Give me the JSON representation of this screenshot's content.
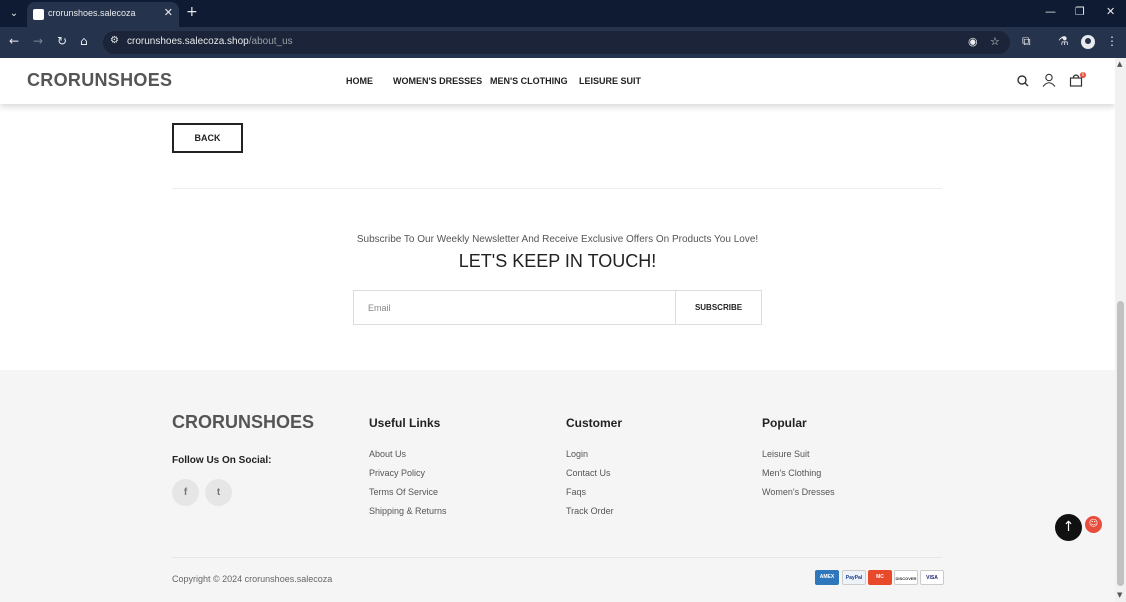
{
  "browser": {
    "tab_title": "crorunshoes.salecoza",
    "url_domain": "crorunshoes.salecoza.shop",
    "url_path": "/about_us",
    "icons": [
      "tab-list-icon",
      "close-icon",
      "plus-icon",
      "minimize-icon",
      "restore-icon",
      "window-close-icon",
      "back-icon",
      "forward-icon",
      "reload-icon",
      "home-icon",
      "site-settings-icon",
      "eye-off-icon",
      "star-icon",
      "extensions-icon",
      "labs-icon",
      "profile-icon",
      "more-icon"
    ]
  },
  "header": {
    "logo": "CRORUNSHOES",
    "nav": [
      "HOME",
      "WOMEN'S DRESSES",
      "MEN'S CLOTHING",
      "LEISURE SUIT"
    ],
    "cart_count": "0"
  },
  "main": {
    "back_label": "BACK"
  },
  "newsletter": {
    "subtitle": "Subscribe To Our Weekly Newsletter And Receive Exclusive Offers On Products You Love!",
    "title": "LET'S KEEP IN TOUCH!",
    "email_placeholder": "Email",
    "subscribe_label": "SUBSCRIBE"
  },
  "footer": {
    "logo": "CRORUNSHOES",
    "follow": "Follow Us On Social:",
    "social": [
      "f",
      "t"
    ],
    "columns": [
      {
        "title": "Useful Links",
        "links": [
          "About Us",
          "Privacy Policy",
          "Terms Of Service",
          "Shipping & Returns"
        ]
      },
      {
        "title": "Customer",
        "links": [
          "Login",
          "Contact Us",
          "Faqs",
          "Track Order"
        ]
      },
      {
        "title": "Popular",
        "links": [
          "Leisure Suit",
          "Men's Clothing",
          "Women's Dresses"
        ]
      }
    ],
    "copyright": "Copyright © 2024 crorunshoes.salecoza",
    "payments": [
      "AMEX",
      "PayPal",
      "MC",
      "DISCOVER",
      "VISA"
    ]
  },
  "colors": {
    "browser_frame": "#0f1b33",
    "toolbar": "#26334d",
    "accent_red": "#e74c3c",
    "footer_bg": "#f5f5f5"
  }
}
